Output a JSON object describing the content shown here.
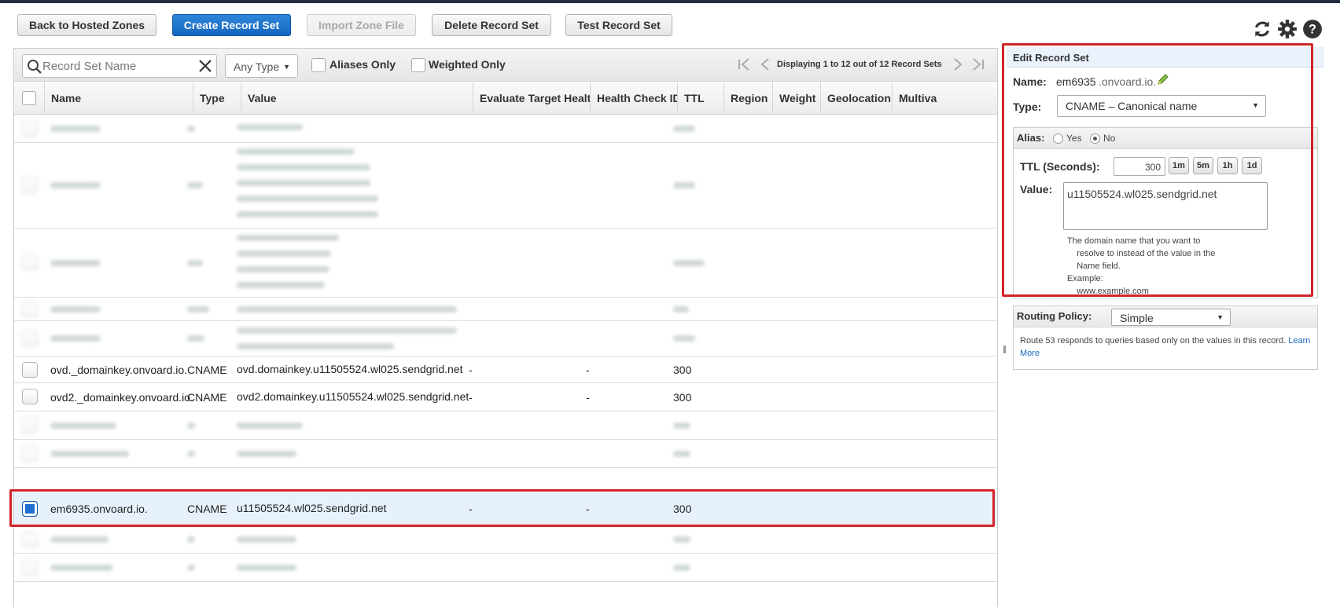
{
  "toolbar": {
    "back_label": "Back to Hosted Zones",
    "create_label": "Create Record Set",
    "import_label": "Import Zone File",
    "delete_label": "Delete Record Set",
    "test_label": "Test Record Set"
  },
  "top_icons": [
    "refresh-icon",
    "gear-icon",
    "help-icon"
  ],
  "filter": {
    "search_placeholder": "Record Set Name",
    "type_value": "Any Type",
    "aliases_only": "Aliases Only",
    "weighted_only": "Weighted Only",
    "pager_text": "Displaying 1 to 12 out of 12 Record Sets"
  },
  "columns": [
    "Name",
    "Type",
    "Value",
    "Evaluate Target Health",
    "Health Check ID",
    "TTL",
    "Region",
    "Weight",
    "Geolocation",
    "Multiva"
  ],
  "rows": [
    {
      "name": "ovd._domainkey.onvoard.io.",
      "type": "CNAME",
      "value": "ovd.domainkey.u11505524.wl025.sendgrid.net",
      "eval": "-",
      "health": "-",
      "ttl": "300"
    },
    {
      "name": "ovd2._domainkey.onvoard.io.",
      "type": "CNAME",
      "value": "ovd2.domainkey.u11505524.wl025.sendgrid.net",
      "eval": "-",
      "health": "-",
      "ttl": "300"
    },
    {
      "name": "em6935.onvoard.io.",
      "type": "CNAME",
      "value": "u11505524.wl025.sendgrid.net",
      "eval": "-",
      "health": "-",
      "ttl": "300"
    }
  ],
  "panel": {
    "title": "Edit Record Set",
    "name_label": "Name:",
    "name_value": "em6935",
    "name_suffix": ".onvoard.io.",
    "type_label": "Type:",
    "type_value": "CNAME – Canonical name",
    "alias_label": "Alias:",
    "alias_yes": "Yes",
    "alias_no": "No",
    "ttl_label": "TTL (Seconds):",
    "ttl_value": "300",
    "ttl_buttons": [
      "1m",
      "5m",
      "1h",
      "1d"
    ],
    "value_label": "Value:",
    "value_text": "u11505524.wl025.sendgrid.net",
    "help_text": "The domain name that you want to\n    resolve to instead of the value in the\n    Name field.\nExample:\n    www.example.com",
    "routing_label": "Routing Policy:",
    "routing_value": "Simple",
    "routing_help": "Route 53 responds to queries based only on the values in this record.",
    "learn_more": "Learn More"
  },
  "colors": {
    "primary": "#1466c0",
    "highlight": "#d0252a",
    "selected_row": "#e7f1fb"
  }
}
